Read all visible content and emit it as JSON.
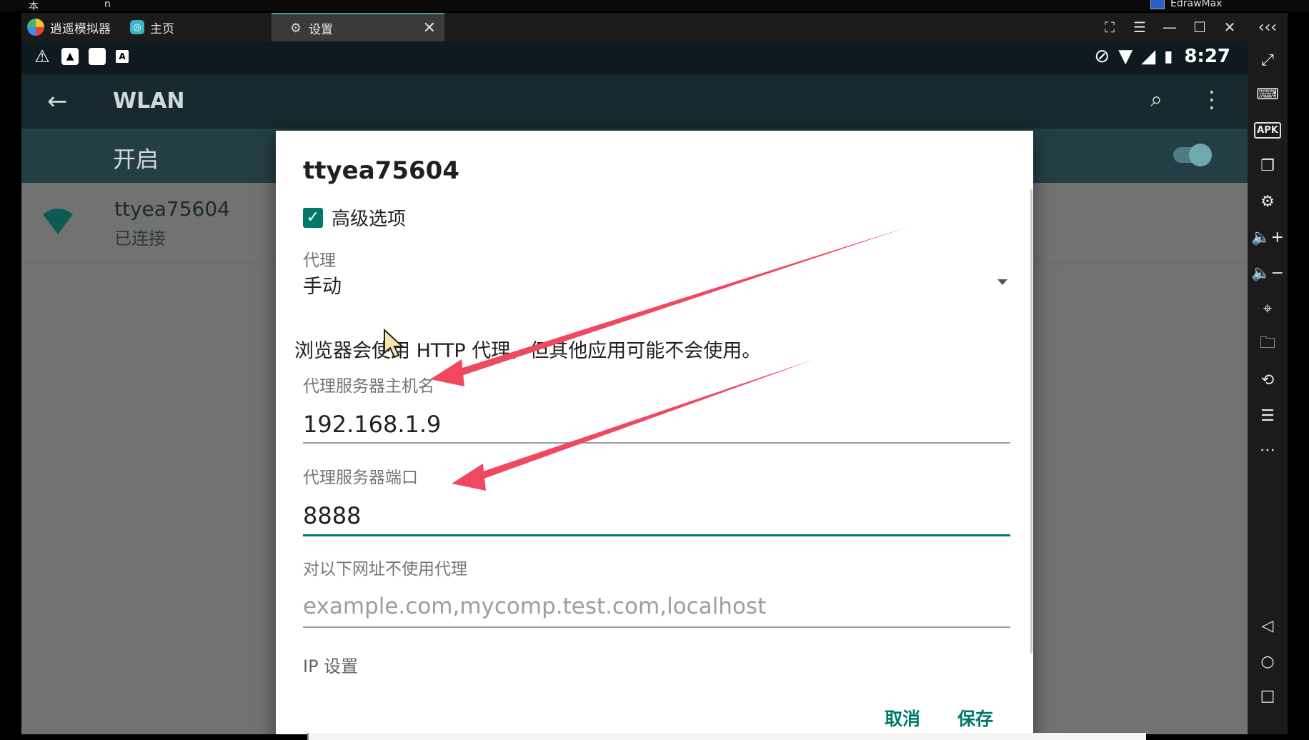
{
  "host": {
    "top_left_text": "本",
    "top_mid_text": "n",
    "edraw_label": "EdrawMax"
  },
  "emulator": {
    "tabs": [
      {
        "label": "逍遥模拟器",
        "icon": "app-logo-icon"
      },
      {
        "label": "主页",
        "icon": "home-app-icon"
      },
      {
        "label": "设置",
        "icon": "settings-gear-icon",
        "active": true,
        "close": "✕"
      }
    ],
    "window_controls": [
      "fullscreen-icon",
      "menu-icon",
      "minimize-icon",
      "maximize-icon",
      "close-icon"
    ],
    "collapse_label": "‹‹‹",
    "sidebar_icons": [
      "expand-icon",
      "keyboard-icon",
      "apk-icon",
      "multi-window-icon",
      "gear-icon",
      "volume-up-icon",
      "volume-down-icon",
      "location-icon",
      "folder-icon",
      "rotate-icon",
      "list-icon",
      "more-icon",
      "back-nav-icon",
      "home-nav-icon",
      "recents-nav-icon"
    ],
    "apk_label": "APK"
  },
  "android": {
    "status": {
      "time": "8:27",
      "left_icons": [
        "warning-icon",
        "photo-icon",
        "app-square-icon",
        "a-icon"
      ],
      "right_icons": [
        "dnd-icon",
        "wifi-icon",
        "signal-icon",
        "battery-icon"
      ]
    },
    "appbar": {
      "back": "←",
      "title": "WLAN"
    },
    "switch": {
      "label": "开启",
      "on": true
    },
    "network": {
      "name": "ttyea75604",
      "status": "已连接"
    }
  },
  "dialog": {
    "title": "ttyea75604",
    "advanced_checked": true,
    "advanced_label": "高级选项",
    "proxy_label": "代理",
    "proxy_value": "手动",
    "note": "浏览器会使用 HTTP 代理，但其他应用可能不会使用。",
    "hostname_label": "代理服务器主机名",
    "hostname_value": "192.168.1.9",
    "port_label": "代理服务器端口",
    "port_value": "8888",
    "bypass_label": "对以下网址不使用代理",
    "bypass_placeholder": "example.com,mycomp.test.com,localhost",
    "ip_label": "IP 设置",
    "cancel_label": "取消",
    "save_label": "保存"
  },
  "colors": {
    "accent": "#00796b",
    "arrow": "#f0485f",
    "appbar": "#15292e"
  }
}
